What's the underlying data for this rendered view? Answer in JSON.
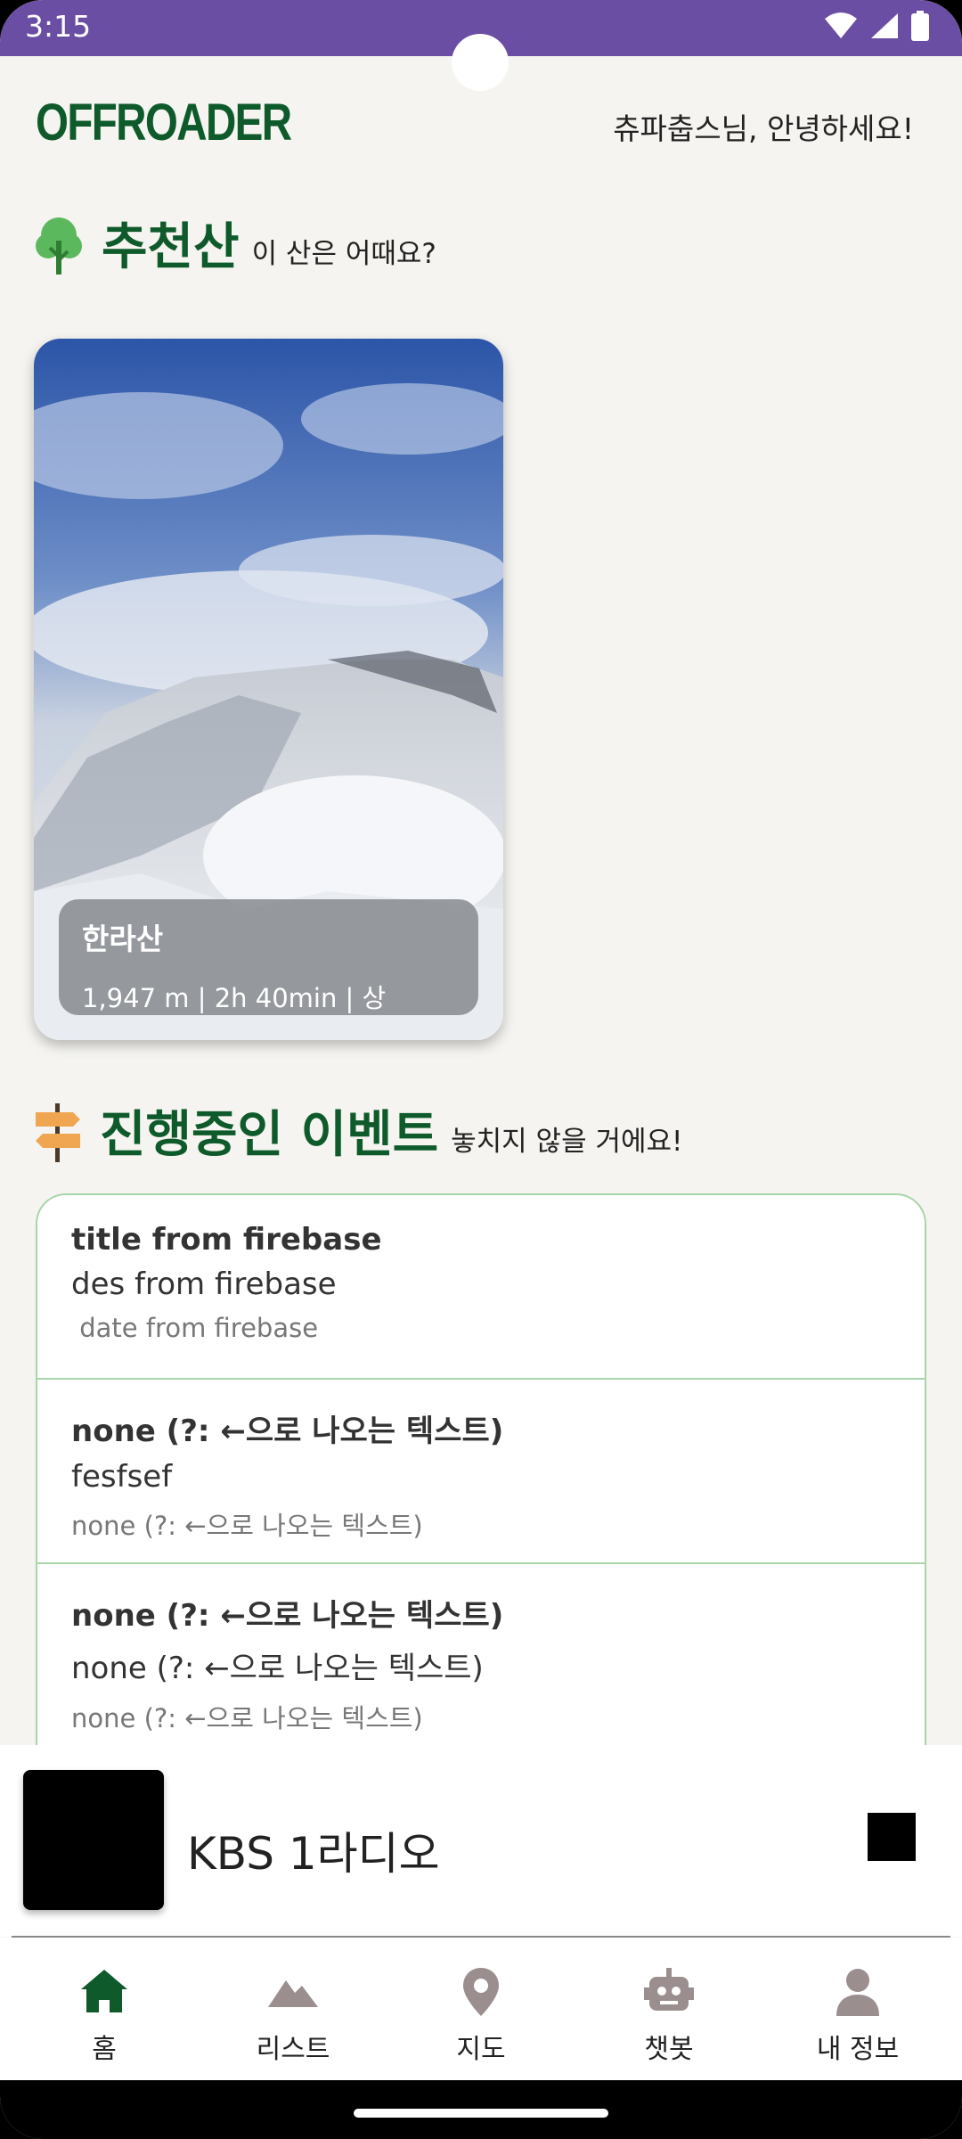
{
  "status_bar": {
    "time": "3:15"
  },
  "header": {
    "logo": "OFFROADER",
    "greeting": "츄파춥스님, 안녕하세요!"
  },
  "recommend": {
    "title": "추천산",
    "subtitle": "이 산은 어때요?",
    "card": {
      "name": "한라산",
      "meta": "1,947 m | 2h 40min | 상"
    }
  },
  "events": {
    "title": "진행중인 이벤트",
    "subtitle": "놓치지 않을 거에요!",
    "items": [
      {
        "title": "title from firebase",
        "desc": "des from firebase",
        "date": " date from firebase"
      },
      {
        "title": "none (?: ←으로 나오는 텍스트)",
        "desc": "fesfsef",
        "date": "none (?: ←으로 나오는 텍스트)"
      },
      {
        "title": "none (?: ←으로 나오는 텍스트)",
        "desc": "none (?: ←으로 나오는 텍스트)",
        "date": "none (?: ←으로 나오는 텍스트)"
      }
    ]
  },
  "player": {
    "station": "KBS 1라디오"
  },
  "nav": {
    "items": [
      {
        "label": "홈",
        "icon": "home-icon",
        "active": true
      },
      {
        "label": "리스트",
        "icon": "mountain-icon"
      },
      {
        "label": "지도",
        "icon": "map-pin-icon"
      },
      {
        "label": "챗봇",
        "icon": "robot-icon"
      },
      {
        "label": "내 정보",
        "icon": "person-icon"
      }
    ]
  },
  "colors": {
    "brand": "#0e5a2a",
    "status_bar": "#6a4ea4",
    "nav_inactive": "#9a8e8e",
    "border": "#a8d6a8"
  }
}
